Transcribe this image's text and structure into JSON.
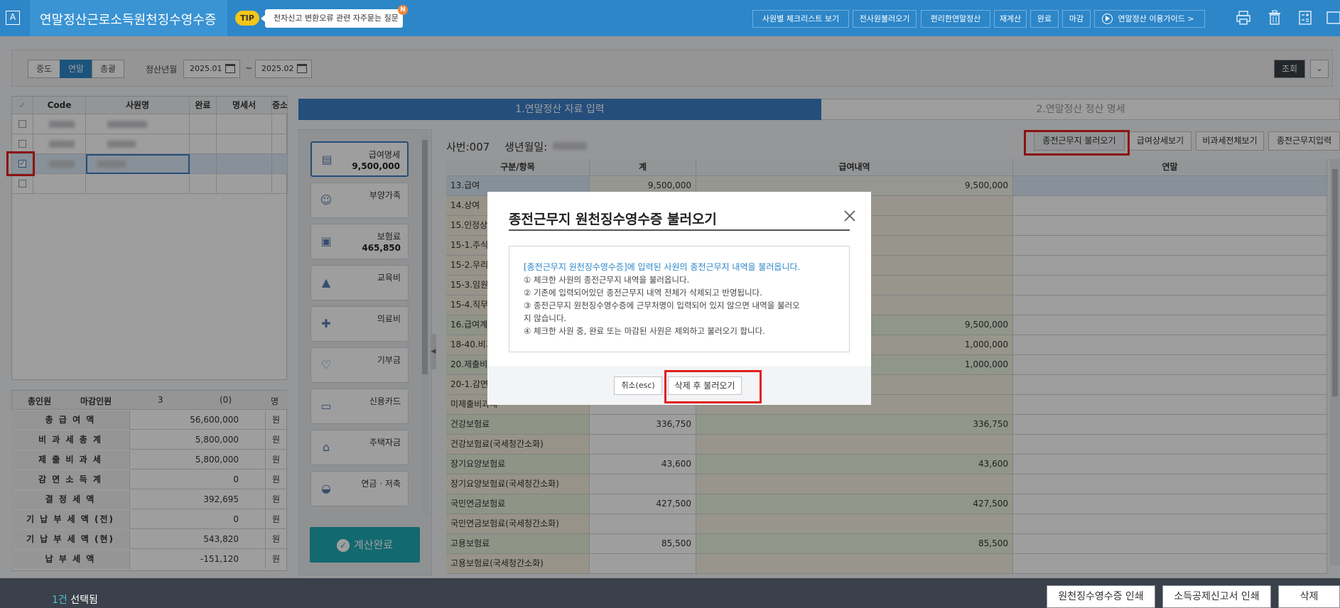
{
  "header": {
    "logo_letter": "A",
    "title": "연말정산근로소득원천징수영수증",
    "tip_badge": "TIP",
    "tip_text": "전자신고 변환오류 관련 자주묻는 질문",
    "tip_dot": "N",
    "buttons": [
      "사원별 체크리스트 보기",
      "전사원불러오기",
      "편리한연말정산",
      "재계산",
      "완료",
      "마감",
      "연말정산 이용가이드 >"
    ],
    "icons": [
      "printer-icon",
      "trash-icon",
      "calculator-icon",
      "expand-icon"
    ]
  },
  "filter": {
    "segments": [
      "중도",
      "연말",
      "총괄"
    ],
    "active_segment": "연말",
    "period_label": "정산년월",
    "date_from": "2025.01",
    "tilde": "~",
    "date_to": "2025.02",
    "search_button": "조회"
  },
  "employee_table": {
    "headers": [
      "Code",
      "사원명",
      "완료",
      "명세서",
      "중소"
    ]
  },
  "summary": {
    "head": [
      "총인원",
      "마감인원",
      "3",
      "(0)",
      "명"
    ],
    "rows": [
      {
        "label": "총 급 여 액",
        "value": "56,600,000",
        "unit": "원"
      },
      {
        "label": "비 과 세 총 계",
        "value": "5,800,000",
        "unit": "원"
      },
      {
        "label": "제 출 비 과 세",
        "value": "5,800,000",
        "unit": "원"
      },
      {
        "label": "감 면 소 득 계",
        "value": "0",
        "unit": "원"
      },
      {
        "label": "결 정 세 액",
        "value": "392,695",
        "unit": "원"
      },
      {
        "label": "기 납 부 세 액 (전)",
        "value": "0",
        "unit": "원"
      },
      {
        "label": "기 납 부 세 액 (현)",
        "value": "543,820",
        "unit": "원"
      },
      {
        "label": "납 부 세 액",
        "value": "-151,120",
        "unit": "원"
      }
    ]
  },
  "steps": {
    "step1": "1.연말정산 자료 입력",
    "step2": "2.연말정산 정산 명세"
  },
  "categories": [
    {
      "name": "급여명세",
      "amount": "9,500,000"
    },
    {
      "name": "부양가족",
      "amount": ""
    },
    {
      "name": "보험료",
      "amount": "465,850"
    },
    {
      "name": "교육비",
      "amount": ""
    },
    {
      "name": "의료비",
      "amount": ""
    },
    {
      "name": "기부금",
      "amount": ""
    },
    {
      "name": "신용카드",
      "amount": ""
    },
    {
      "name": "주택자금",
      "amount": ""
    },
    {
      "name": "연금 · 저축",
      "amount": ""
    }
  ],
  "calc_done": "계산완료",
  "employee_info": {
    "sabun": "사번:007",
    "birth_label": "생년월일:"
  },
  "right_buttons": [
    "종전근무지 불러오기",
    "급여상세보기",
    "비과세전체보기",
    "종전근무지입력"
  ],
  "main_table": {
    "headers": [
      "구분/항목",
      "계",
      "급여내역",
      "연말"
    ],
    "rows": [
      {
        "item": "13.급여",
        "total": "9,500,000",
        "pay": "9,500,000"
      },
      {
        "item": "14.상여",
        "total": "",
        "pay": ""
      },
      {
        "item": "15.인정상",
        "total": "",
        "pay": ""
      },
      {
        "item": "15-1.주식",
        "total": "",
        "pay": ""
      },
      {
        "item": "15-2.우리",
        "total": "",
        "pay": ""
      },
      {
        "item": "15-3.임원",
        "total": "",
        "pay": ""
      },
      {
        "item": "15-4.직무",
        "total": "",
        "pay": ""
      },
      {
        "item": "16.급여계",
        "total": "",
        "pay": "9,500,000"
      },
      {
        "item": "18-40.비과",
        "total": "",
        "pay": "1,000,000"
      },
      {
        "item": "20.제출비",
        "total": "",
        "pay": "1,000,000"
      },
      {
        "item": "20-1.감면",
        "total": "",
        "pay": ""
      },
      {
        "item": "미제출비과세",
        "total": "",
        "pay": ""
      },
      {
        "item": "건강보험료",
        "total": "336,750",
        "pay": "336,750"
      },
      {
        "item": "건강보험료(국세청간소화)",
        "total": "",
        "pay": ""
      },
      {
        "item": "장기요양보험료",
        "total": "43,600",
        "pay": "43,600"
      },
      {
        "item": "장기요양보험료(국세청간소화)",
        "total": "",
        "pay": ""
      },
      {
        "item": "국민연금보험료",
        "total": "427,500",
        "pay": "427,500"
      },
      {
        "item": "국민연금보험료(국세청간소화)",
        "total": "",
        "pay": ""
      },
      {
        "item": "고용보험료",
        "total": "85,500",
        "pay": "85,500"
      },
      {
        "item": "고용보험료(국세청간소화)",
        "total": "",
        "pay": ""
      }
    ]
  },
  "modal": {
    "title": "종전근무지 원천징수영수증 불러오기",
    "lead": "[종전근무지 원천징수영수증]에 입력된 사원의 종전근무지 내역을 불러옵니다.",
    "lines": [
      "① 체크한 사원의 종전근무지 내역을 불러옵니다.",
      "② 기존에 입력되어있던 종전근무지 내역 전체가 삭제되고 반영됩니다.",
      "③ 종전근무지 원천징수영수증에 근무처명이 입력되어 있지 않으면 내역을 불러오",
      "지 않습니다.",
      "④ 체크한 사원 중, 완료 또는 마감된 사원은 제외하고 불러오기 합니다."
    ],
    "cancel": "취소(esc)",
    "confirm": "삭제 후 불러오기"
  },
  "footer": {
    "count": "1건",
    "selected": "선택됨",
    "buttons": [
      "원천징수영수증 인쇄",
      "소득공제신고서 인쇄",
      "삭제"
    ]
  },
  "colors": {
    "header_blue": "#2d86c8",
    "step_blue": "#3d7fc8",
    "calc_teal": "#1faab5",
    "highlight_red": "#e02020"
  }
}
